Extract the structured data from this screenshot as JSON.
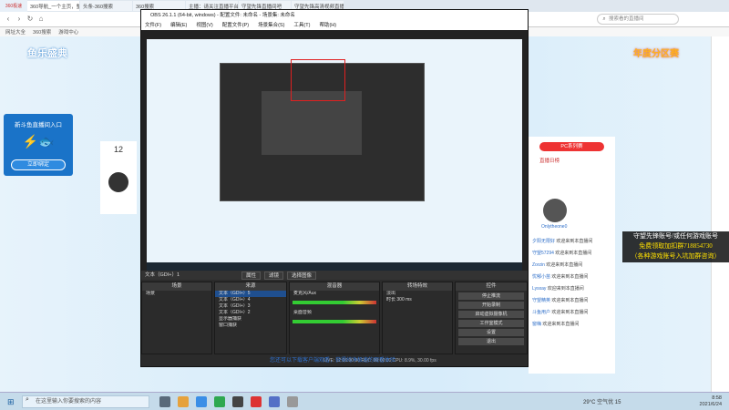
{
  "browser": {
    "logo": "360极速",
    "tabs": [
      "360导航_一个主页，整个世界",
      "头条-360搜索",
      "360搜索",
      "主播：请关注直播平台",
      "守望先锋直播间吧",
      "守望先锋高清视频直播-斗鱼"
    ],
    "search_placeholder": "搜索看的直播间",
    "bookmarks": [
      "网址大全",
      "360搜索",
      "游戏中心"
    ]
  },
  "site": {
    "banner_left": "鱼乐盛典",
    "banner_right": "年度分区赛",
    "promo_title": "新斗鱼直播间入口",
    "promo_button": "立即绑定",
    "viewer_count": "12",
    "rank_pk": "PC系列赛",
    "rank_hot": "直播日榜",
    "streamer": "Onlytheone0",
    "chat": [
      {
        "user": "夕阳无限好",
        "msg": "欢迎来到本直播间"
      },
      {
        "user": "守望57294",
        "msg": "欢迎来到本直播间"
      },
      {
        "user": "Zorzin",
        "msg": "欢迎来到本直播间"
      },
      {
        "user": "忧郁小苗",
        "msg": "欢迎来到本直播间"
      },
      {
        "user": "Lysxay",
        "msg": "欢迎来到本直播间"
      },
      {
        "user": "守望精英",
        "msg": "欢迎来到本直播间"
      },
      {
        "user": "斗鱼用户",
        "msg": "欢迎来到本直播间"
      },
      {
        "user": "窗嗨",
        "msg": "欢迎来到本直播间"
      }
    ],
    "caption": "您还可以下载客户端观看，获得纯净极速的观看体验",
    "overlay": [
      "守望先锋账号/或任何游戏账号",
      "免费领取加扣群718854730",
      "（各种游戏账号入坑加群咨询）"
    ]
  },
  "obs": {
    "title": "OBS 26.1.1 (64-bit, windows) - 配置文件: 未命名 - 场景集: 未命名",
    "menu": [
      "文件(F)",
      "编辑(E)",
      "视图(V)",
      "配置文件(P)",
      "场景集合(S)",
      "工具(T)",
      "帮助(H)"
    ],
    "source_bar": "文本（GDI+）1",
    "source_buttons": [
      "属性",
      "滤镜",
      "选择图像"
    ],
    "docks": {
      "scenes": {
        "title": "场景",
        "items": [
          "场景"
        ]
      },
      "sources": {
        "title": "来源",
        "items": [
          "文本（GDI+）5",
          "文本（GDI+）4",
          "文本（GDI+）3",
          "文本（GDI+）2",
          "显示器捕获",
          "窗口捕获"
        ]
      },
      "mixer": {
        "title": "混音器",
        "tracks": [
          "麦克风/Aux",
          "桌面音频"
        ]
      },
      "transitions": {
        "title": "转场特效",
        "type": "淡出",
        "duration_label": "时长",
        "duration": "300 ms"
      },
      "controls": {
        "title": "控件",
        "buttons": [
          "停止推流",
          "开始录制",
          "启动虚拟摄像机",
          "工作室模式",
          "设置",
          "退出"
        ]
      }
    },
    "status": "LIVE: 12:06:00:00  REC: 00:00:00  CPU: 8.9%, 30.00 fps"
  },
  "taskbar": {
    "search_placeholder": "在这里输入你要搜索的内容",
    "weather": "29°C 空气优 15",
    "time": "8:58",
    "date": "2021/6/24"
  },
  "colors": {
    "obs_bg": "#2b2b2b",
    "accent": "#2f6fc9",
    "overlay_gold": "#ffd600"
  }
}
